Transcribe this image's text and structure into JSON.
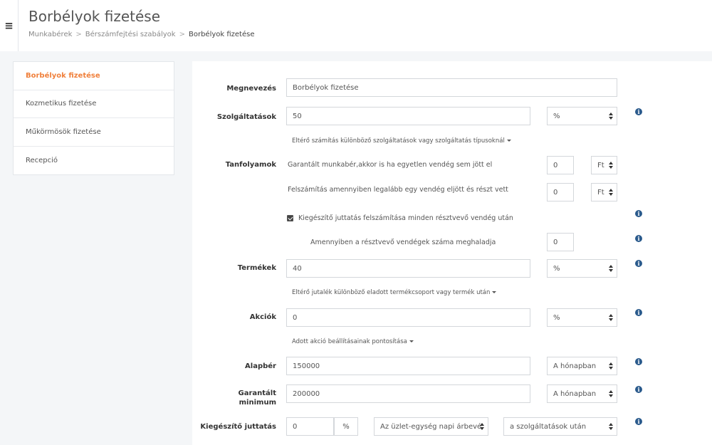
{
  "header": {
    "title": "Borbélyok fizetése",
    "breadcrumb": [
      "Munkabérek",
      "Bérszámfejtési szabályok",
      "Borbélyok fizetése"
    ]
  },
  "sidebar": {
    "items": [
      {
        "label": "Borbélyok fizetése"
      },
      {
        "label": "Kozmetikus fizetése"
      },
      {
        "label": "Műkörmösök fizetése"
      },
      {
        "label": "Recepció"
      }
    ]
  },
  "form": {
    "megnevezes": {
      "label": "Megnevezés",
      "value": "Borbélyok fizetése"
    },
    "szolgaltatasok": {
      "label": "Szolgáltatások",
      "value": "50",
      "unit": "%",
      "link": "Eltérő számítás különböző szolgáltatások vagy szolgáltatás típusoknál"
    },
    "tanfolyamok": {
      "label": "Tanfolyamok",
      "row1_text": "Garantált munkabér,akkor is ha egyetlen vendég sem jött el",
      "row1_value": "0",
      "row1_unit": "Ft",
      "row2_text": "Felszámítás amennyiben legalább egy vendég eljött és részt vett",
      "row2_value": "0",
      "row2_unit": "Ft",
      "checkbox_text": "Kiegészítő juttatás felszámítása minden résztvevő vendég után",
      "threshold_text": "Amennyiben a résztvevő vendégek száma meghaladja",
      "threshold_value": "0"
    },
    "termekek": {
      "label": "Termékek",
      "value": "40",
      "unit": "%",
      "link": "Eltérő jutalék különböző eladott termékcsoport vagy termék után"
    },
    "akciok": {
      "label": "Akciók",
      "value": "0",
      "unit": "%",
      "link": "Adott akció beállításainak pontosítása"
    },
    "alapber": {
      "label": "Alapbér",
      "value": "150000",
      "unit": "A hónapban"
    },
    "garantalt": {
      "label_line1": "Garantált",
      "label_line2": "minimum",
      "value": "200000",
      "unit": "A hónapban"
    },
    "kiegeszito": {
      "label": "Kiegészítő juttatás",
      "value": "0",
      "pct": "%",
      "base": "Az üzlet-egység napi árbevé",
      "basis": "a szolgáltatások után"
    }
  },
  "icons": {
    "info": "i"
  }
}
